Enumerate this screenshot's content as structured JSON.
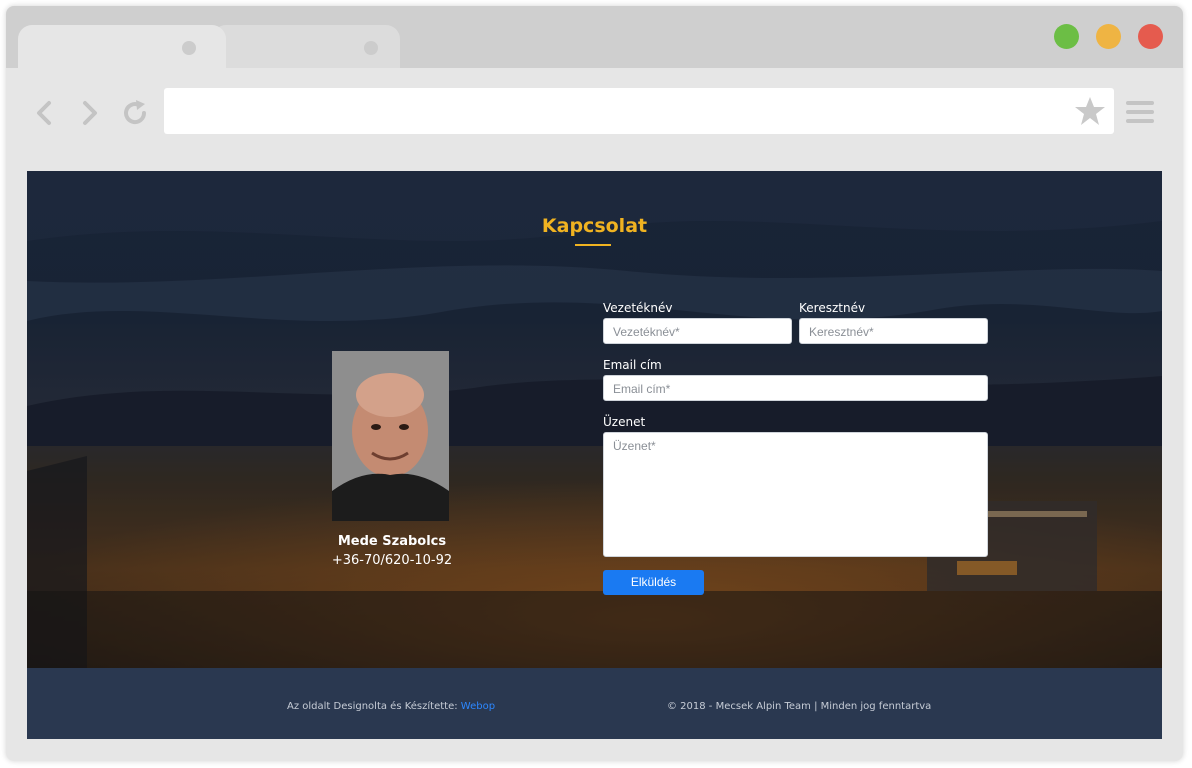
{
  "browser": {
    "tabs": [
      {
        "label": ""
      },
      {
        "label": ""
      }
    ],
    "window_buttons": [
      {
        "name": "maximize-button",
        "color": "#6cbe45"
      },
      {
        "name": "minimize-button",
        "color": "#efb443"
      },
      {
        "name": "close-button",
        "color": "#e55b4e"
      }
    ],
    "toolbar": {
      "back_icon": "chevron-left-icon",
      "forward_icon": "chevron-right-icon",
      "reload_icon": "reload-icon",
      "address_value": "",
      "bookmark_icon": "star-icon",
      "menu_icon": "hamburger-icon"
    }
  },
  "page": {
    "section_title": "Kapcsolat",
    "accent_color": "#f0b321",
    "contact_person": {
      "name": "Mede Szabolcs",
      "phone": "+36-70/620-10-92"
    },
    "form": {
      "last_name_label": "Vezetéknév",
      "last_name_placeholder": "Vezetéknév*",
      "first_name_label": "Keresztnév",
      "first_name_placeholder": "Keresztnév*",
      "email_label": "Email cím",
      "email_placeholder": "Email cím*",
      "message_label": "Üzenet",
      "message_placeholder": "Üzenet*",
      "submit_label": "Elküldés"
    },
    "footer": {
      "credit_text": "Az oldalt Designolta és Készítette: ",
      "credit_link": "Webop",
      "copyright": "© 2018 - Mecsek Alpin Team | Minden jog fenntartva"
    }
  }
}
